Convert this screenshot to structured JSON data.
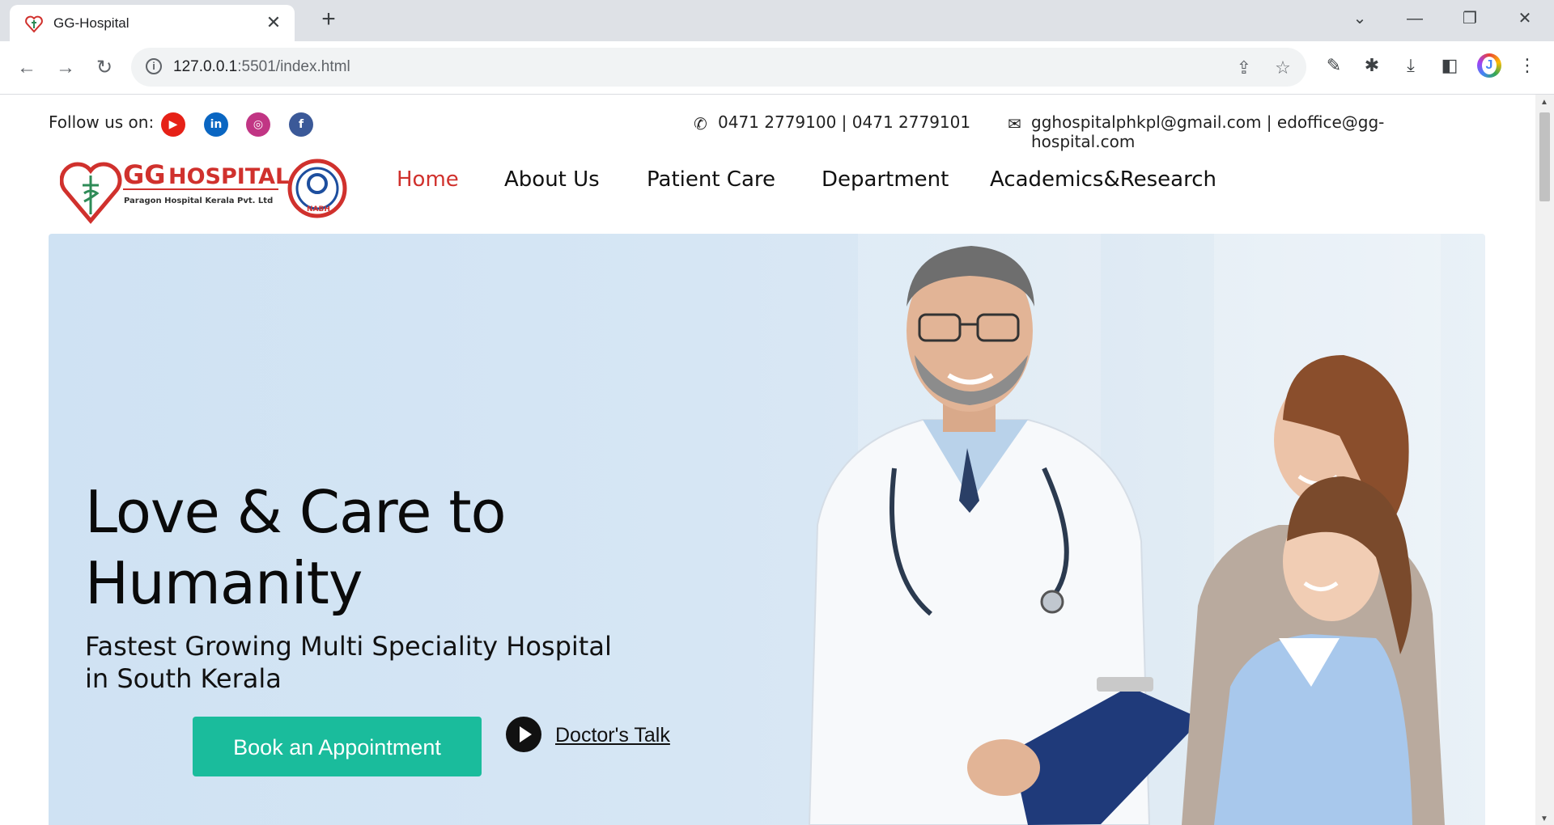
{
  "browser": {
    "tab_title": "GG-Hospital",
    "url_host": "127.0.0.1",
    "url_rest": ":5501/index.html"
  },
  "topbar": {
    "follow_label": "Follow us on:",
    "social": [
      {
        "name": "youtube",
        "color": "#e62117",
        "glyph": "▶"
      },
      {
        "name": "linkedin",
        "color": "#0a66c2",
        "glyph": "in"
      },
      {
        "name": "instagram",
        "color": "#c13584",
        "glyph": "◎"
      },
      {
        "name": "facebook",
        "color": "#3b5998",
        "glyph": "f"
      }
    ],
    "phones": "0471 2779100 | 0471 2779101",
    "emails": "gghospitalphkpl@gmail.com | edoffice@gg-hospital.com"
  },
  "logo": {
    "brand_gg": "GG",
    "brand_hospital": "HOSPITAL",
    "tagline": "Paragon Hospital Kerala Pvt. Ltd",
    "badge_text": "NABH"
  },
  "nav": {
    "items": [
      "Home",
      "About Us",
      "Patient Care",
      "Department",
      "Academics&Research"
    ],
    "active_color": "#d0312d"
  },
  "hero": {
    "headline": "Love & Care to Humanity",
    "subheadline": "Fastest Growing Multi Speciality Hospital in South Kerala",
    "cta_label": "Book an Appointment",
    "cta_color": "#1abc9c",
    "video_link": "Doctor's Talk"
  }
}
